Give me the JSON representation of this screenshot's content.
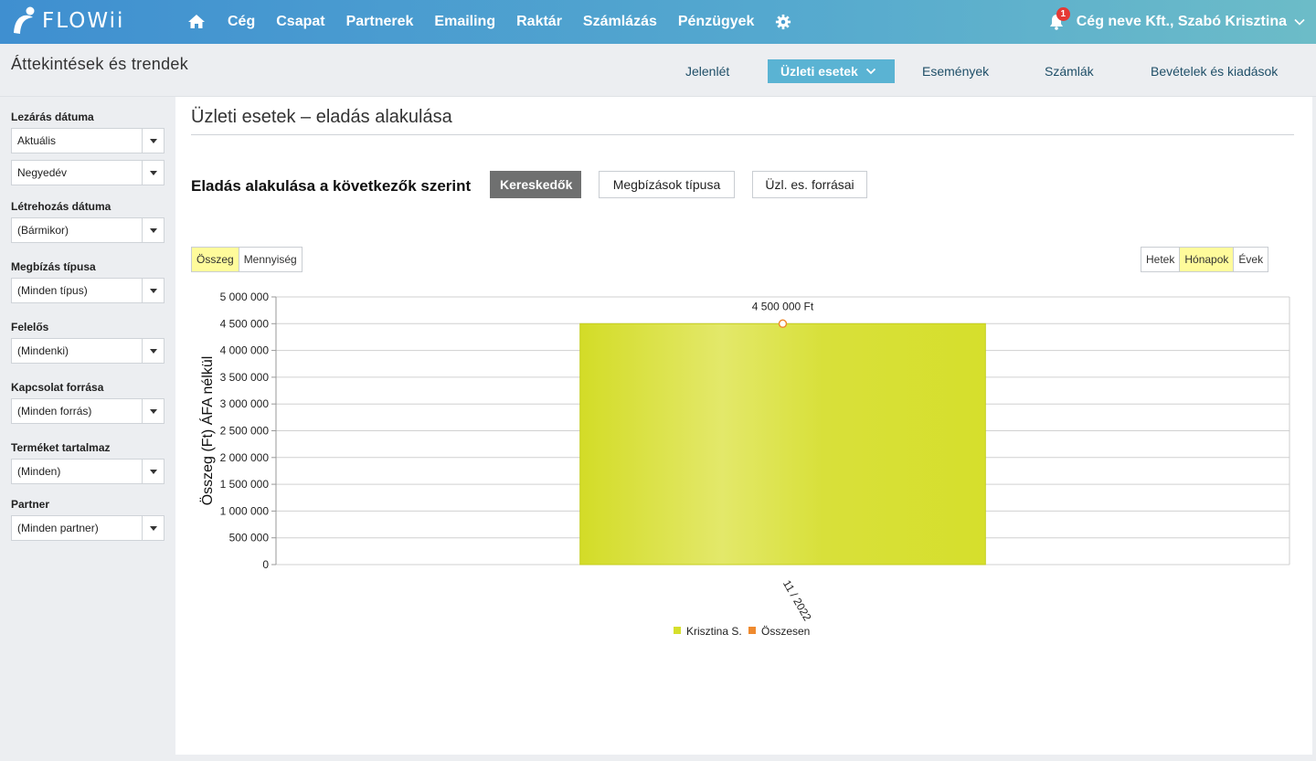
{
  "brand": {
    "name": "FLOWii"
  },
  "nav": {
    "home_icon": "home-icon",
    "items": [
      "Cég",
      "Csapat",
      "Partnerek",
      "Emailing",
      "Raktár",
      "Számlázás",
      "Pénzügyek"
    ],
    "settings_icon": "gear-icon",
    "notifications": {
      "icon": "bell-icon",
      "count": "1"
    },
    "user": "Cég neve Kft., Szabó Krisztina"
  },
  "subheader": {
    "title": "Áttekintések és trendek",
    "tabs": [
      "Jelenlét",
      "Üzleti esetek",
      "Események",
      "Számlák",
      "Bevételek és kiadások"
    ],
    "active_tab": "Üzleti esetek"
  },
  "filters": [
    {
      "label": "Lezárás dátuma",
      "values": [
        "Aktuális",
        "Negyedév"
      ]
    },
    {
      "label": "Létrehozás dátuma",
      "values": [
        "(Bármikor)"
      ]
    },
    {
      "label": "Megbízás típusa",
      "values": [
        "(Minden típus)"
      ]
    },
    {
      "label": "Felelős",
      "values": [
        "(Mindenki)"
      ]
    },
    {
      "label": "Kapcsolat forrása",
      "values": [
        "(Minden forrás)"
      ]
    },
    {
      "label": "Terméket tartalmaz",
      "values": [
        "(Minden)"
      ]
    },
    {
      "label": "Partner",
      "values": [
        "(Minden partner)"
      ]
    }
  ],
  "main": {
    "title": "Üzleti esetek – eladás alakulása",
    "group_label": "Eladás alakulása a következők szerint",
    "group_buttons": [
      "Kereskedők",
      "Megbízások típusa",
      "Üzl. es. forrásai"
    ],
    "group_active": "Kereskedők",
    "measure_toggle": {
      "options": [
        "Összeg",
        "Mennyiség"
      ],
      "active": "Összeg"
    },
    "period_toggle": {
      "options": [
        "Hetek",
        "Hónapok",
        "Évek"
      ],
      "active": "Hónapok"
    }
  },
  "colors": {
    "series_bar": "#d6df2c",
    "series_total": "#ef8a2f",
    "accent": "#5ab3d3"
  },
  "chart_data": {
    "type": "bar",
    "categories": [
      "11 / 2022"
    ],
    "series": [
      {
        "name": "Krisztina S.",
        "type": "bar",
        "values": [
          4500000
        ]
      },
      {
        "name": "Összesen",
        "type": "line",
        "values": [
          4500000
        ]
      }
    ],
    "data_labels": [
      "4 500 000 Ft"
    ],
    "ylabel": "Összeg (Ft) ÁFA nélkül",
    "ylim": [
      0,
      5000000
    ],
    "yticks": [
      0,
      500000,
      1000000,
      1500000,
      2000000,
      2500000,
      3000000,
      3500000,
      4000000,
      4500000,
      5000000
    ],
    "ytick_labels": [
      "0",
      "500 000",
      "1 000 000",
      "1 500 000",
      "2 000 000",
      "2 500 000",
      "3 000 000",
      "3 500 000",
      "4 000 000",
      "4 500 000",
      "5 000 000"
    ],
    "grid": true,
    "legend": "bottom-center"
  }
}
